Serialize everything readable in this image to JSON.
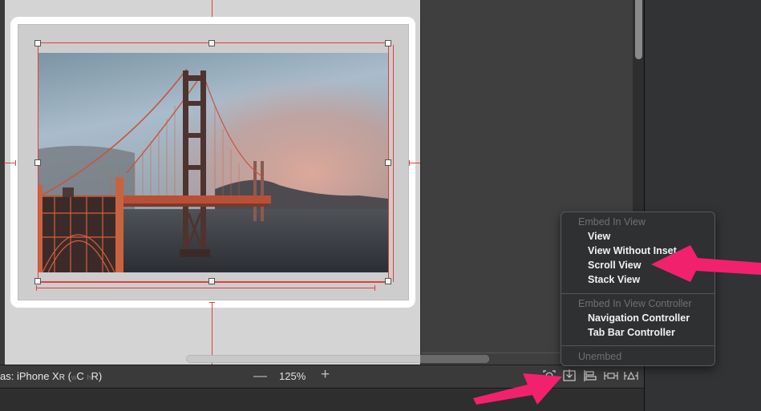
{
  "toolbar": {
    "device_prefix": "as: iPhone X",
    "device_suffix_r": "R",
    "size_class_open": "(",
    "size_class_w": "w",
    "size_class_w_value": "C",
    "size_class_h": "h",
    "size_class_h_value": "R",
    "size_class_close": ")",
    "zoom_out_label": "—",
    "zoom_level": "125%",
    "zoom_in_label": "+",
    "icons": [
      "update-frames-icon",
      "embed-in-icon",
      "align-icon",
      "add-constraints-icon",
      "resolve-autolayout-icon"
    ]
  },
  "menu": {
    "sections": [
      {
        "header": "Embed In View",
        "items": [
          "View",
          "View Without Inset",
          "Scroll View",
          "Stack View"
        ]
      },
      {
        "header": "Embed In View Controller",
        "items": [
          "Navigation Controller",
          "Tab Bar Controller"
        ]
      },
      {
        "header": "Unembed",
        "items": []
      }
    ],
    "highlighted_item": "Scroll View"
  },
  "canvas": {
    "image_subject": "Golden Gate Bridge photo",
    "selected_element": "image-view"
  },
  "annotations": {
    "arrow_color": "#f2216e",
    "constraint_color": "#e0413b"
  }
}
